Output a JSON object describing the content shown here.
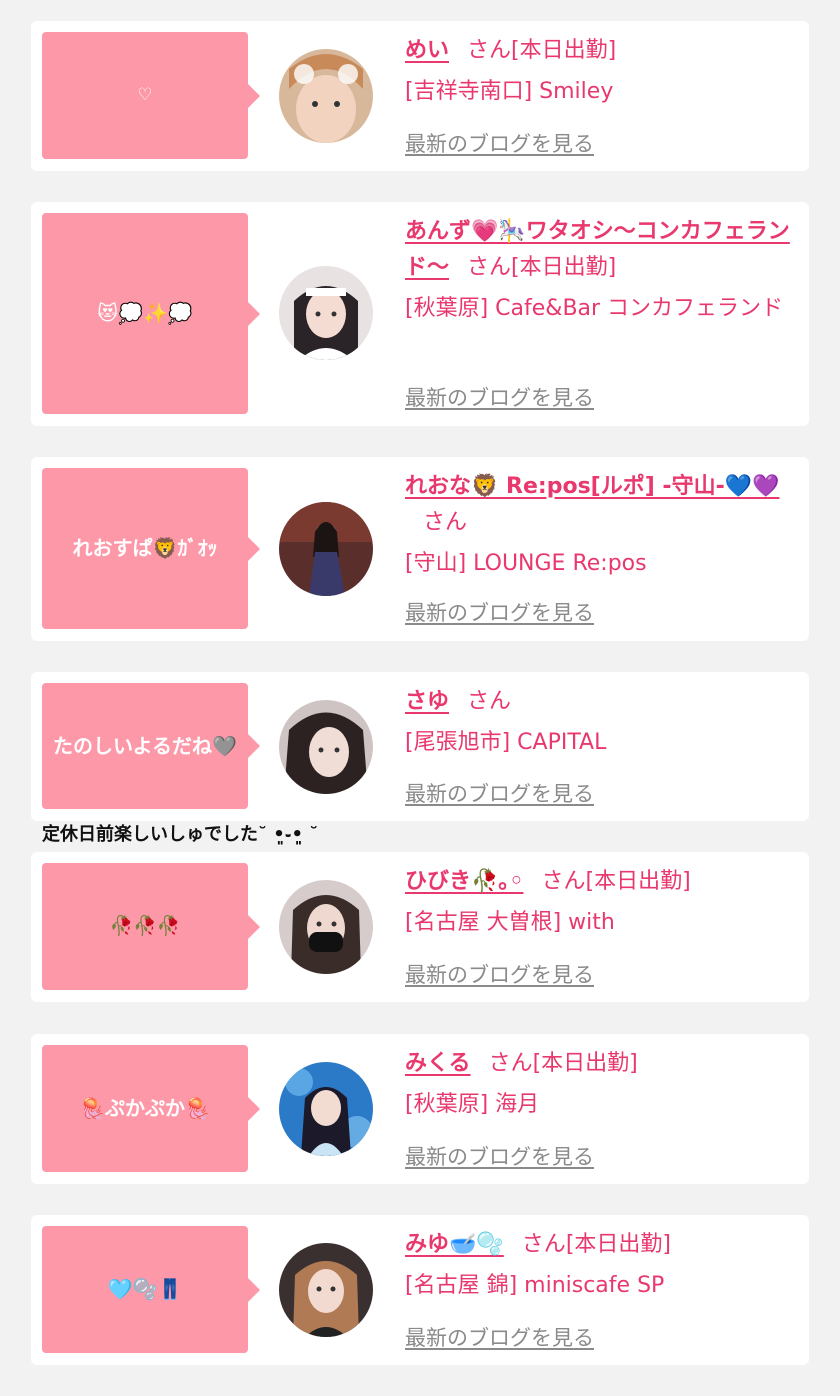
{
  "cards": [
    {
      "bubble": "♡",
      "name": "めい",
      "san": "さん",
      "status": "[本日出勤]",
      "shop": "[吉祥寺南口] Smiley",
      "blog": "最新のブログを見る"
    },
    {
      "bubble": "😻💭✨💭",
      "name": "あんず💗🎠ワタオシ〜コンカフェランド〜",
      "san": "さん",
      "status": "[本日出勤]",
      "shop": "[秋葉原] Cafe&Bar コンカフェランド",
      "blog": "最新のブログを見る"
    },
    {
      "bubble": "れおすぱ🦁ｶﾞｵｯ",
      "name": "れおな🦁 Re:pos[ルポ] -守山-💙💜",
      "san": "さん",
      "status": "",
      "shop": "[守山] LOUNGE Re:pos",
      "blog": "最新のブログを見る"
    },
    {
      "bubble": "たのしいよるだね🩶",
      "name": "さゆ",
      "san": "さん",
      "status": "",
      "shop": "[尾張旭市] CAPITAL",
      "blog": "最新のブログを見る"
    },
    {
      "bubble": "🥀🥀🥀",
      "name": "ひびき🥀｡◦",
      "san": "さん",
      "status": "[本日出勤]",
      "shop": "[名古屋 大曽根] with",
      "blog": "最新のブログを見る"
    },
    {
      "bubble": "🪼ぷかぷか🪼",
      "name": "みくる",
      "san": "さん",
      "status": "[本日出勤]",
      "shop": "[秋葉原] 海月",
      "blog": "最新のブログを見る"
    },
    {
      "bubble": "🩵🫧👖",
      "name": "みゆ🥣🫧",
      "san": "さん",
      "status": "[本日出勤]",
      "shop": "[名古屋 錦] miniscafe SP",
      "blog": "最新のブログを見る"
    }
  ],
  "note": "定休日前楽しいしゅでした˘ •͈֊•͈ ˘",
  "colors": {
    "accent": "#e8386d",
    "bubble": "#fd98a8",
    "link_gray": "#8a8a8a",
    "background": "#f2f2f2"
  }
}
